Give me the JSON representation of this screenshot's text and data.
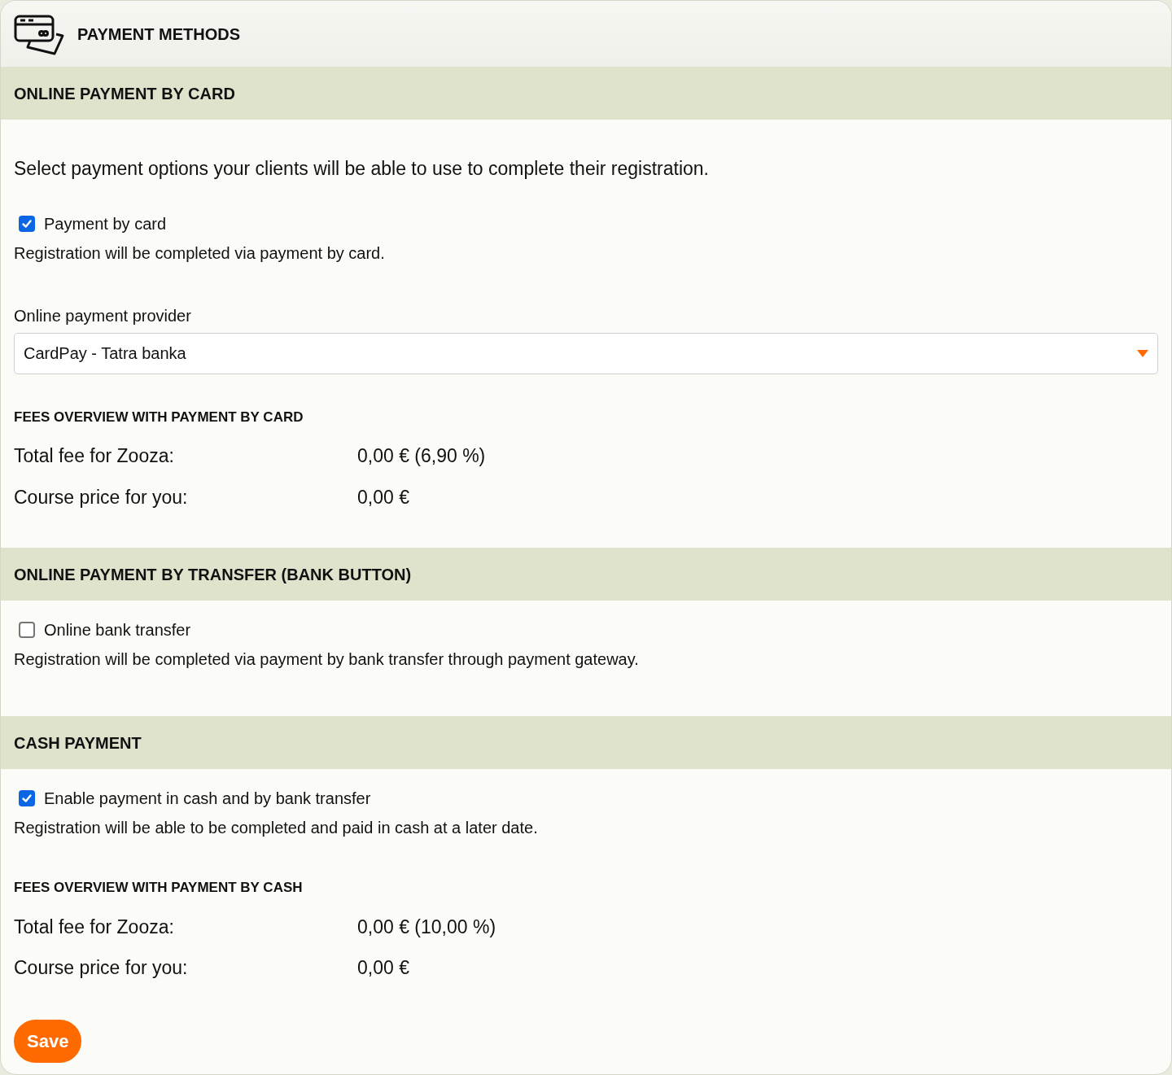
{
  "header": {
    "title": "PAYMENT METHODS"
  },
  "sections": [
    {
      "title": "ONLINE PAYMENT BY CARD",
      "intro": "Select payment options your clients will be able to use to complete their registration.",
      "options": [
        {
          "label": "Payment by card",
          "checked": true,
          "description": "Registration will be completed via payment by card."
        }
      ],
      "provider": {
        "label": "Online payment provider",
        "value": "CardPay - Tatra banka"
      },
      "fees": {
        "title": "FEES OVERVIEW WITH PAYMENT BY CARD",
        "rows": [
          {
            "label": "Total fee for Zooza:",
            "value": "0,00 € (6,90 %)"
          },
          {
            "label": "Course price for you:",
            "value": "0,00 €"
          }
        ]
      }
    },
    {
      "title": "ONLINE PAYMENT BY TRANSFER (BANK BUTTON)",
      "options": [
        {
          "label": "Online bank transfer",
          "checked": false,
          "description": "Registration will be completed via payment by bank transfer through payment gateway."
        }
      ]
    },
    {
      "title": "CASH PAYMENT",
      "options": [
        {
          "label": "Enable payment in cash and by bank transfer",
          "checked": true,
          "description": "Registration will be able to be completed and paid in cash at a later date."
        }
      ],
      "fees": {
        "title": "FEES OVERVIEW WITH PAYMENT BY CASH",
        "rows": [
          {
            "label": "Total fee for Zooza:",
            "value": "0,00 € (10,00 %)"
          },
          {
            "label": "Course price for you:",
            "value": "0,00 €"
          }
        ]
      }
    }
  ],
  "save_button": "Save"
}
